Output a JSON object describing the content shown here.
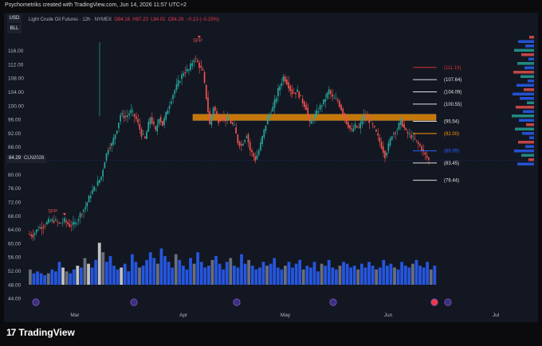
{
  "header": {
    "caption": "Psychometriks created with TradingView.com, Jun 14, 2026 11:57 UTC+2"
  },
  "legend": {
    "title": "Light Crude Oil Futures · 12h · NYMEX",
    "o_label": "O",
    "o": "84.16",
    "h_label": "H",
    "h": "87.23",
    "l_label": "L",
    "l": "84.01",
    "c_label": "C",
    "c": "84.29",
    "change": "−0.13 (−0.15%)"
  },
  "buttons": {
    "usd": "USD",
    "bll": "BLL"
  },
  "current_price": {
    "value": "84.29",
    "symbol": "CLN2026"
  },
  "chart_data": {
    "type": "candlestick",
    "y_ticks": [
      "116.00",
      "112.00",
      "108.00",
      "104.00",
      "100.00",
      "96.00",
      "92.00",
      "88.00",
      "84.00",
      "80.00",
      "76.00",
      "72.00",
      "68.00",
      "64.00",
      "60.00",
      "56.00",
      "52.00",
      "48.00",
      "44.00"
    ],
    "ylim": [
      43,
      119
    ],
    "x_ticks": [
      "Mar",
      "Apr",
      "May",
      "Jun",
      "Jul"
    ],
    "level_labels": [
      {
        "text": "(111.19)",
        "value": 111.19,
        "color": "#d32f2f"
      },
      {
        "text": "(107.64)",
        "value": 107.64,
        "color": "#e0e0e0"
      },
      {
        "text": "(104.09)",
        "value": 104.09,
        "color": "#e0e0e0"
      },
      {
        "text": "(100.55)",
        "value": 100.55,
        "color": "#e0e0e0"
      },
      {
        "text": "(95.54)",
        "value": 95.54,
        "color": "#e0e0e0"
      },
      {
        "text": "(92.00)",
        "value": 92.0,
        "color": "#ff9800"
      },
      {
        "text": "(86.99)",
        "value": 86.99,
        "color": "#2962ff"
      },
      {
        "text": "(83.45)",
        "value": 83.45,
        "color": "#e0e0e0"
      },
      {
        "text": "(78.44)",
        "value": 78.44,
        "color": "#e0e0e0"
      }
    ],
    "zone": {
      "low": 95.8,
      "high": 97.6,
      "color": "#ff9800"
    },
    "annotations": [
      {
        "text": "SFP",
        "x_date": "2026-02-20",
        "value": 69.5
      },
      {
        "text": "SFP",
        "x_date": "2026-04-07",
        "value": 119
      }
    ],
    "path_points": [
      [
        0,
        62.8
      ],
      [
        3,
        62.5
      ],
      [
        6,
        64.5
      ],
      [
        9,
        65.2
      ],
      [
        12,
        66.5
      ],
      [
        15,
        66.8
      ],
      [
        18,
        65.8
      ],
      [
        21,
        66.7
      ],
      [
        24,
        65.3
      ],
      [
        27,
        65.8
      ],
      [
        30,
        68.5
      ],
      [
        33,
        70.8
      ],
      [
        36,
        74.5
      ],
      [
        39,
        76.8
      ],
      [
        42,
        79.5
      ],
      [
        44,
        84.2
      ],
      [
        46,
        87.9
      ],
      [
        48,
        88.8
      ],
      [
        51,
        93.5
      ],
      [
        53,
        97.5
      ],
      [
        56,
        96.8
      ],
      [
        59,
        98.5
      ],
      [
        62,
        96.2
      ],
      [
        65,
        91.8
      ],
      [
        67,
        90.4
      ],
      [
        70,
        96.8
      ],
      [
        73,
        92.6
      ],
      [
        75,
        96.8
      ],
      [
        77,
        94.5
      ],
      [
        80,
        99.2
      ],
      [
        83,
        103.5
      ],
      [
        86,
        106.8
      ],
      [
        89,
        109.8
      ],
      [
        92,
        110.5
      ],
      [
        95,
        113.8
      ],
      [
        97,
        112.6
      ],
      [
        100,
        109.8
      ],
      [
        102,
        102.5
      ],
      [
        104,
        94.5
      ],
      [
        106,
        99.8
      ],
      [
        109,
        95.8
      ],
      [
        111,
        96.9
      ],
      [
        113,
        96.1
      ],
      [
        115,
        95.9
      ],
      [
        118,
        93.8
      ],
      [
        120,
        89.6
      ],
      [
        122,
        88.5
      ],
      [
        125,
        91.8
      ],
      [
        127,
        87.2
      ],
      [
        130,
        84.5
      ],
      [
        132,
        87.1
      ],
      [
        135,
        92.8
      ],
      [
        137,
        96.5
      ],
      [
        140,
        99.4
      ],
      [
        143,
        104.5
      ],
      [
        146,
        108.5
      ],
      [
        148,
        106.9
      ],
      [
        151,
        103.8
      ],
      [
        154,
        104.2
      ],
      [
        156,
        102.1
      ],
      [
        159,
        99.5
      ],
      [
        161,
        94.8
      ],
      [
        164,
        97.2
      ],
      [
        167,
        99.8
      ],
      [
        169,
        101.2
      ],
      [
        172,
        104.5
      ],
      [
        174,
        102.3
      ],
      [
        177,
        101.5
      ],
      [
        179,
        99.2
      ],
      [
        182,
        95.3
      ],
      [
        185,
        92.6
      ],
      [
        187,
        94.2
      ],
      [
        189,
        93.5
      ],
      [
        192,
        97.1
      ],
      [
        194,
        96.4
      ],
      [
        197,
        94.2
      ],
      [
        199,
        92.1
      ],
      [
        202,
        88.3
      ],
      [
        204,
        85.6
      ],
      [
        206,
        88.5
      ],
      [
        208,
        91.8
      ],
      [
        211,
        93.2
      ],
      [
        213,
        95.8
      ],
      [
        216,
        92.4
      ],
      [
        219,
        91.2
      ],
      [
        222,
        89.5
      ],
      [
        224,
        88.3
      ],
      [
        227,
        85.6
      ],
      [
        229,
        84.3
      ]
    ],
    "volume": [
      8,
      6,
      7,
      6,
      5,
      6,
      8,
      7,
      12,
      9,
      7,
      6,
      8,
      10,
      9,
      14,
      11,
      9,
      13,
      22,
      17,
      12,
      15,
      10,
      8,
      9,
      11,
      7,
      16,
      12,
      9,
      10,
      13,
      17,
      14,
      11,
      19,
      15,
      12,
      9,
      16,
      13,
      10,
      8,
      14,
      11,
      17,
      12,
      9,
      10,
      13,
      15,
      11,
      8,
      12,
      14,
      10,
      9,
      16,
      11,
      13,
      10,
      8,
      9,
      12,
      10,
      11,
      14,
      9,
      8,
      10,
      12,
      9,
      11,
      13,
      8,
      10,
      9,
      12,
      7,
      11,
      10,
      13,
      9,
      8,
      10,
      12,
      11,
      9,
      10,
      8,
      11,
      9,
      12,
      10,
      8,
      9,
      13,
      10,
      11,
      9,
      8,
      12,
      10,
      9,
      11,
      13,
      10,
      9,
      12,
      8,
      10
    ],
    "volume_highlights": [
      9,
      13,
      16,
      19,
      25
    ],
    "event_icons": [
      {
        "x_date": "2026-02-10",
        "icon": "arrow-circle-icon"
      },
      {
        "x_date": "2026-03-20",
        "icon": "arrow-circle-icon"
      },
      {
        "x_date": "2026-04-20",
        "icon": "arrow-circle-icon"
      },
      {
        "x_date": "2026-05-20",
        "icon": "arrow-circle-icon"
      },
      {
        "x_date": "2026-06-18",
        "icon": "lightning-icon"
      },
      {
        "x_date": "2026-06-24",
        "icon": "arrow-circle-icon"
      }
    ]
  },
  "colors": {
    "up": "#26a69a",
    "down": "#ef5350",
    "volume": "#2962ff",
    "background": "#131722"
  },
  "footer": {
    "brand": "TradingView",
    "mark": "17"
  }
}
